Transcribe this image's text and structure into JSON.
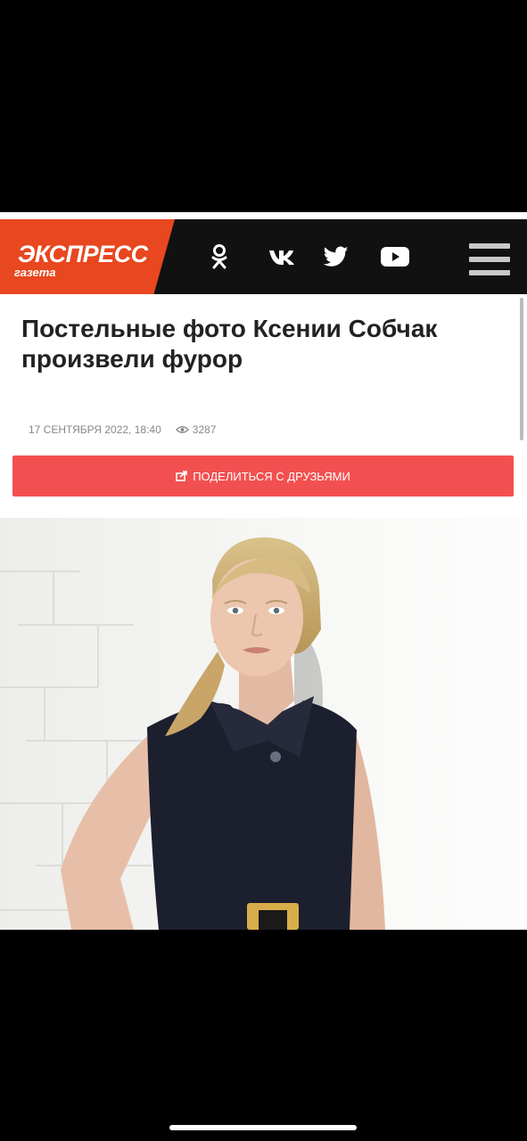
{
  "header": {
    "logo_main": "ЭКСПРЕСС",
    "logo_sub": "газета",
    "brand_color": "#e8471f",
    "social_icons": [
      "odnoklassniki-icon",
      "vk-icon",
      "twitter-icon",
      "youtube-icon"
    ],
    "menu_icon": "hamburger-menu-icon"
  },
  "article": {
    "title": "Постельные фото Ксении Собчак произвели фурор",
    "date": "17 сентября 2022, 18:40",
    "views": "3287",
    "share_label": "поделиться с друзьями",
    "share_color": "#f25050"
  }
}
